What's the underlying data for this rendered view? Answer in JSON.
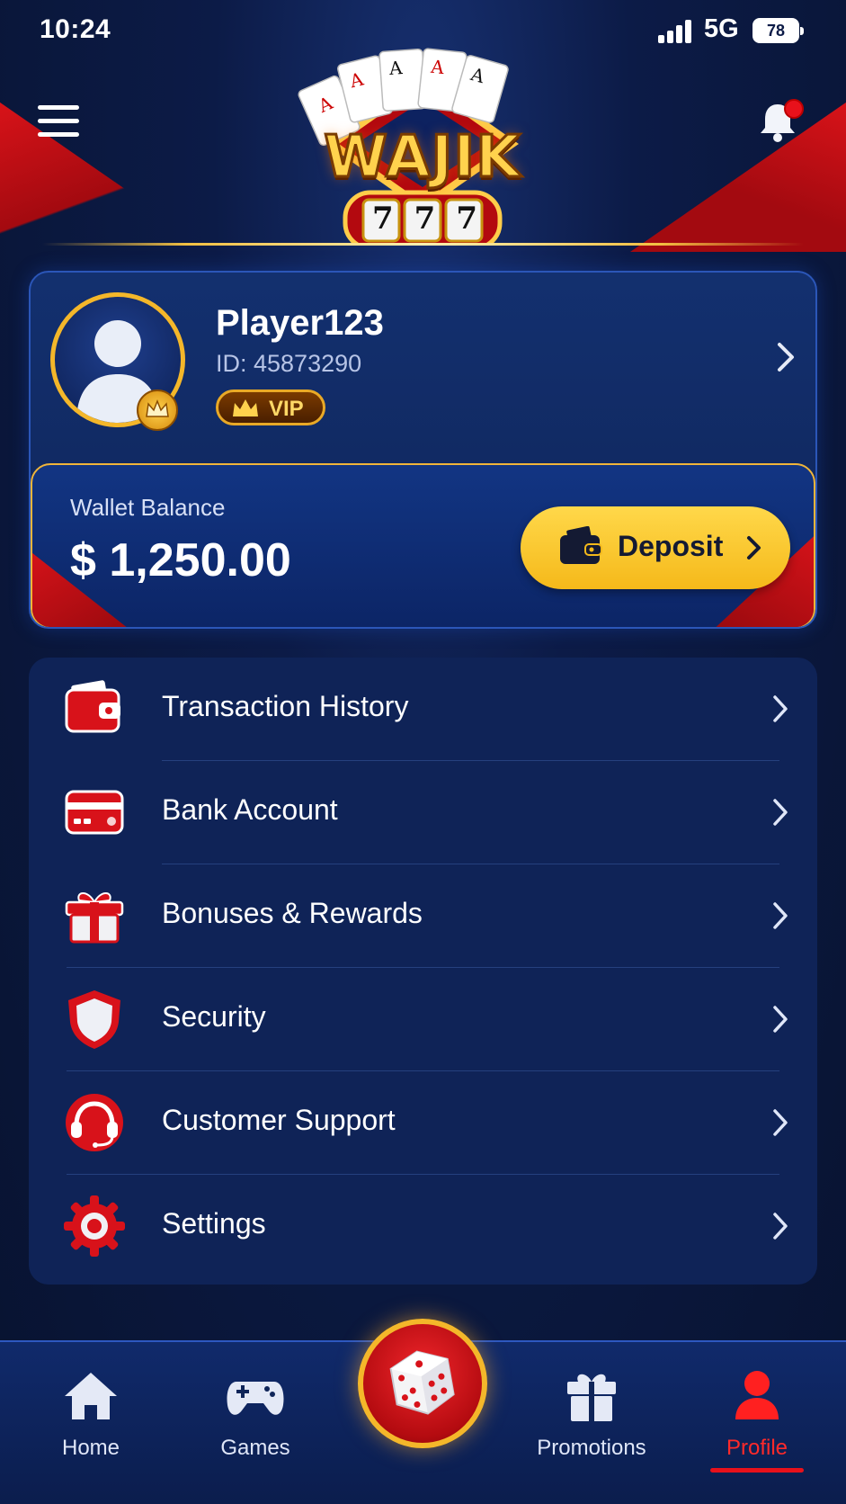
{
  "status_bar": {
    "time": "10:24",
    "network": "5G",
    "battery": "78"
  },
  "header": {
    "logo_text": "WAJIK",
    "logo_numbers": "777"
  },
  "profile": {
    "username": "Player123",
    "user_id": "ID: 45873290",
    "tier": "VIP"
  },
  "wallet": {
    "label": "Wallet Balance",
    "balance": "$ 1,250.00",
    "deposit_label": "Deposit"
  },
  "menu": {
    "items": [
      {
        "label": "Transaction History",
        "icon": "wallet-icon"
      },
      {
        "label": "Bank Account",
        "icon": "credit-card-icon"
      },
      {
        "label": "Bonuses & Rewards",
        "icon": "gift-icon"
      },
      {
        "label": "Security",
        "icon": "shield-icon"
      },
      {
        "label": "Customer Support",
        "icon": "headset-icon"
      },
      {
        "label": "Settings",
        "icon": "gear-icon"
      }
    ]
  },
  "bottom_nav": {
    "items": [
      {
        "label": "Home",
        "icon": "home-icon"
      },
      {
        "label": "Games",
        "icon": "gamepad-icon"
      },
      {
        "label": "Promotions",
        "icon": "gift-icon"
      },
      {
        "label": "Profile",
        "icon": "user-icon"
      }
    ],
    "active": "Profile",
    "center_icon": "dice-icon"
  },
  "colors": {
    "accent_red": "#e8111b",
    "gold": "#f4b72a",
    "background": "#0c1b47"
  }
}
